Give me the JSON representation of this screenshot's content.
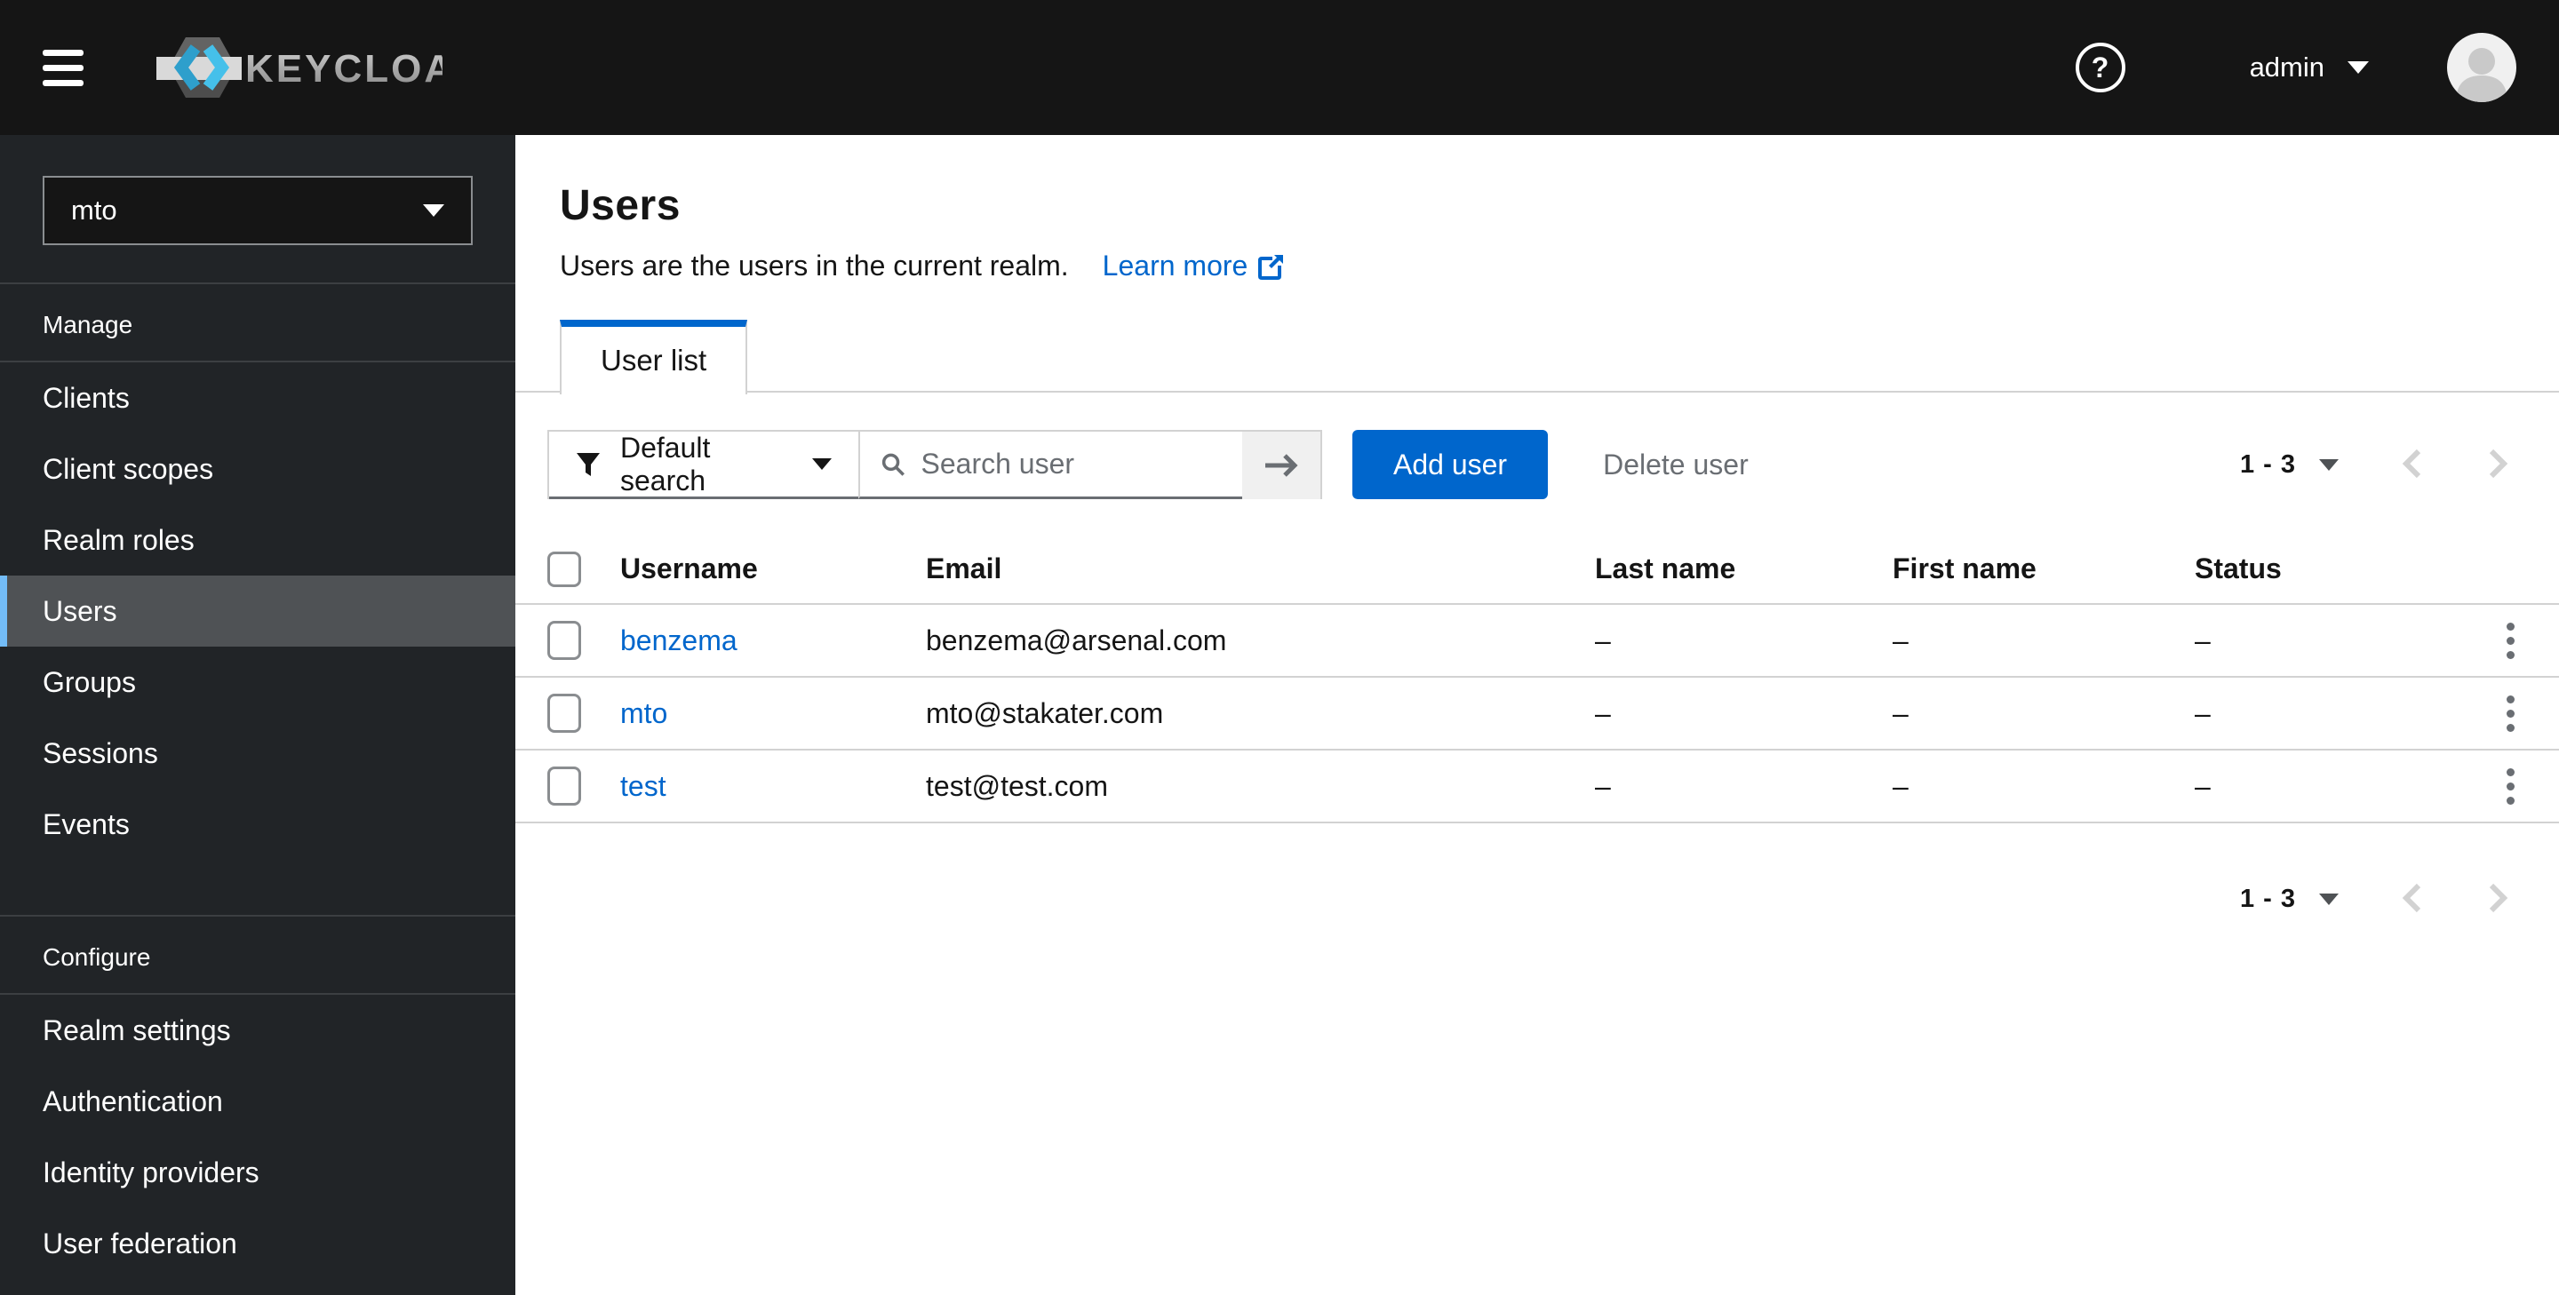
{
  "masthead": {
    "brand_name": "KEYCLOAK",
    "user_menu_label": "admin"
  },
  "sidebar": {
    "realm_selector": {
      "value": "mto"
    },
    "sections": [
      {
        "label": "Manage",
        "items": [
          {
            "label": "Clients",
            "selected": false
          },
          {
            "label": "Client scopes",
            "selected": false
          },
          {
            "label": "Realm roles",
            "selected": false
          },
          {
            "label": "Users",
            "selected": true
          },
          {
            "label": "Groups",
            "selected": false
          },
          {
            "label": "Sessions",
            "selected": false
          },
          {
            "label": "Events",
            "selected": false
          }
        ]
      },
      {
        "label": "Configure",
        "items": [
          {
            "label": "Realm settings",
            "selected": false
          },
          {
            "label": "Authentication",
            "selected": false
          },
          {
            "label": "Identity providers",
            "selected": false
          },
          {
            "label": "User federation",
            "selected": false
          }
        ]
      }
    ]
  },
  "main": {
    "title": "Users",
    "subtitle": "Users are the users in the current realm.",
    "learn_more_label": "Learn more",
    "tabs": [
      {
        "label": "User list",
        "active": true
      }
    ],
    "toolbar": {
      "filter_label": "Default search",
      "search_placeholder": "Search user",
      "add_button_label": "Add user",
      "delete_button_label": "Delete user",
      "pagination_range": "1 - 3"
    },
    "table": {
      "columns": [
        "Username",
        "Email",
        "Last name",
        "First name",
        "Status"
      ],
      "rows": [
        {
          "username": "benzema",
          "email": "benzema@arsenal.com",
          "last_name": "–",
          "first_name": "–",
          "status": "–"
        },
        {
          "username": "mto",
          "email": "mto@stakater.com",
          "last_name": "–",
          "first_name": "–",
          "status": "–"
        },
        {
          "username": "test",
          "email": "test@test.com",
          "last_name": "–",
          "first_name": "–",
          "status": "–"
        }
      ]
    },
    "bottom_pagination_range": "1 - 3"
  },
  "colors": {
    "masthead_bg": "#151515",
    "sidebar_bg": "#212427",
    "nav_selected_bg": "#4f5255",
    "nav_selected_accent": "#73bcf7",
    "primary_blue": "#0066cc",
    "link_blue": "#0066cc",
    "muted_gray": "#6a6e73",
    "border_gray": "#d2d2d2",
    "logo_cyan": "#35b2e0"
  }
}
